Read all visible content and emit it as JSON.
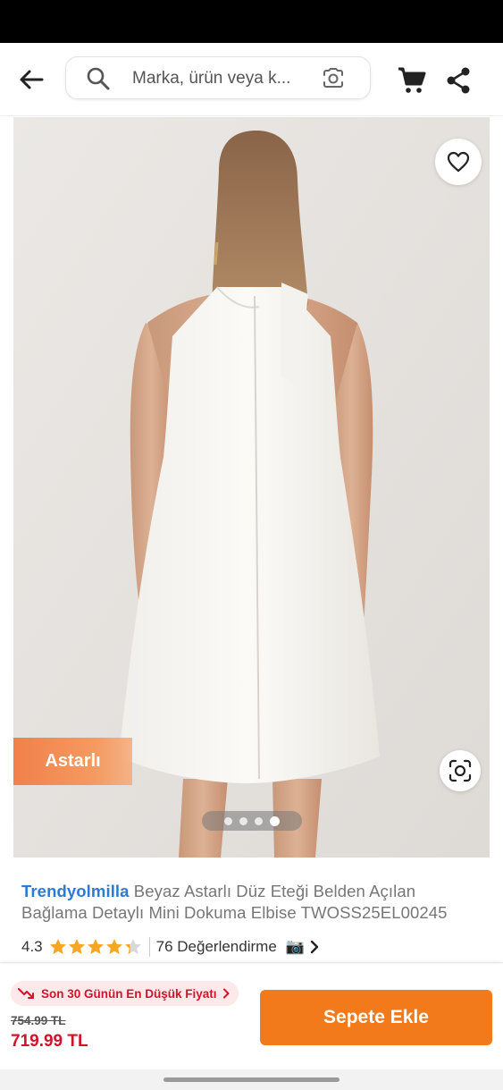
{
  "search": {
    "placeholder": "Marka, ürün veya k..."
  },
  "icons": {
    "back": "arrow-left",
    "search": "magnifier",
    "camera_search": "camera-lens",
    "cart": "shopping-cart",
    "share": "share-nodes",
    "favorite": "heart-outline",
    "visual_search": "scan-lens",
    "price_drop": "trend-down-arrow",
    "chevron": "chevron-right",
    "reviews_camera": "camera-emoji"
  },
  "gallery": {
    "badge": "Astarlı",
    "image_count": 4,
    "active_index": 3
  },
  "product": {
    "brand": "Trendyolmilla",
    "name": " Beyaz Astarlı Düz Eteği Belden Açılan Bağlama Detaylı Mini Dokuma Elbise TWOSS25EL00245",
    "rating": "4.3",
    "rating_value": 4.3,
    "rating_max": 5,
    "reviews": "76 Değerlendirme",
    "reviews_emoji": "📷"
  },
  "purchase": {
    "low_price_label": "Son 30 Günün En Düşük Fiyatı",
    "old_price": "754.99 TL",
    "new_price": "719.99 TL",
    "add_to_cart": "Sepete Ekle"
  },
  "colors": {
    "accent": "#f27a1a",
    "brand_blue": "#2b7bd6",
    "price_red": "#d0142b",
    "star_gold": "#f5a623"
  }
}
